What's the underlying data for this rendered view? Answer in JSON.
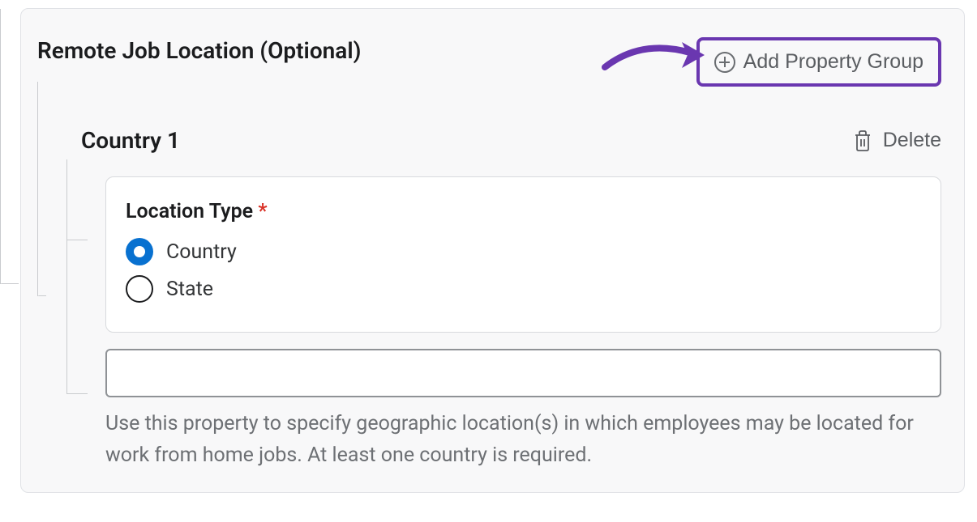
{
  "panel": {
    "title": "Remote Job Location (Optional)",
    "add_group_label": "Add Property Group"
  },
  "group": {
    "title": "Country 1",
    "delete_label": "Delete",
    "location_type": {
      "label": "Location Type",
      "required_marker": "*",
      "options": {
        "country": "Country",
        "state": "State"
      },
      "selected": "country"
    },
    "input_value": "",
    "help_text": "Use this property to specify geographic location(s) in which employees may be located for work from home jobs. At least one country is required."
  },
  "colors": {
    "highlight": "#6a37b0",
    "primary": "#0871d0",
    "text": "#1b1c1e",
    "muted": "#6d7074",
    "required": "#d93025"
  }
}
